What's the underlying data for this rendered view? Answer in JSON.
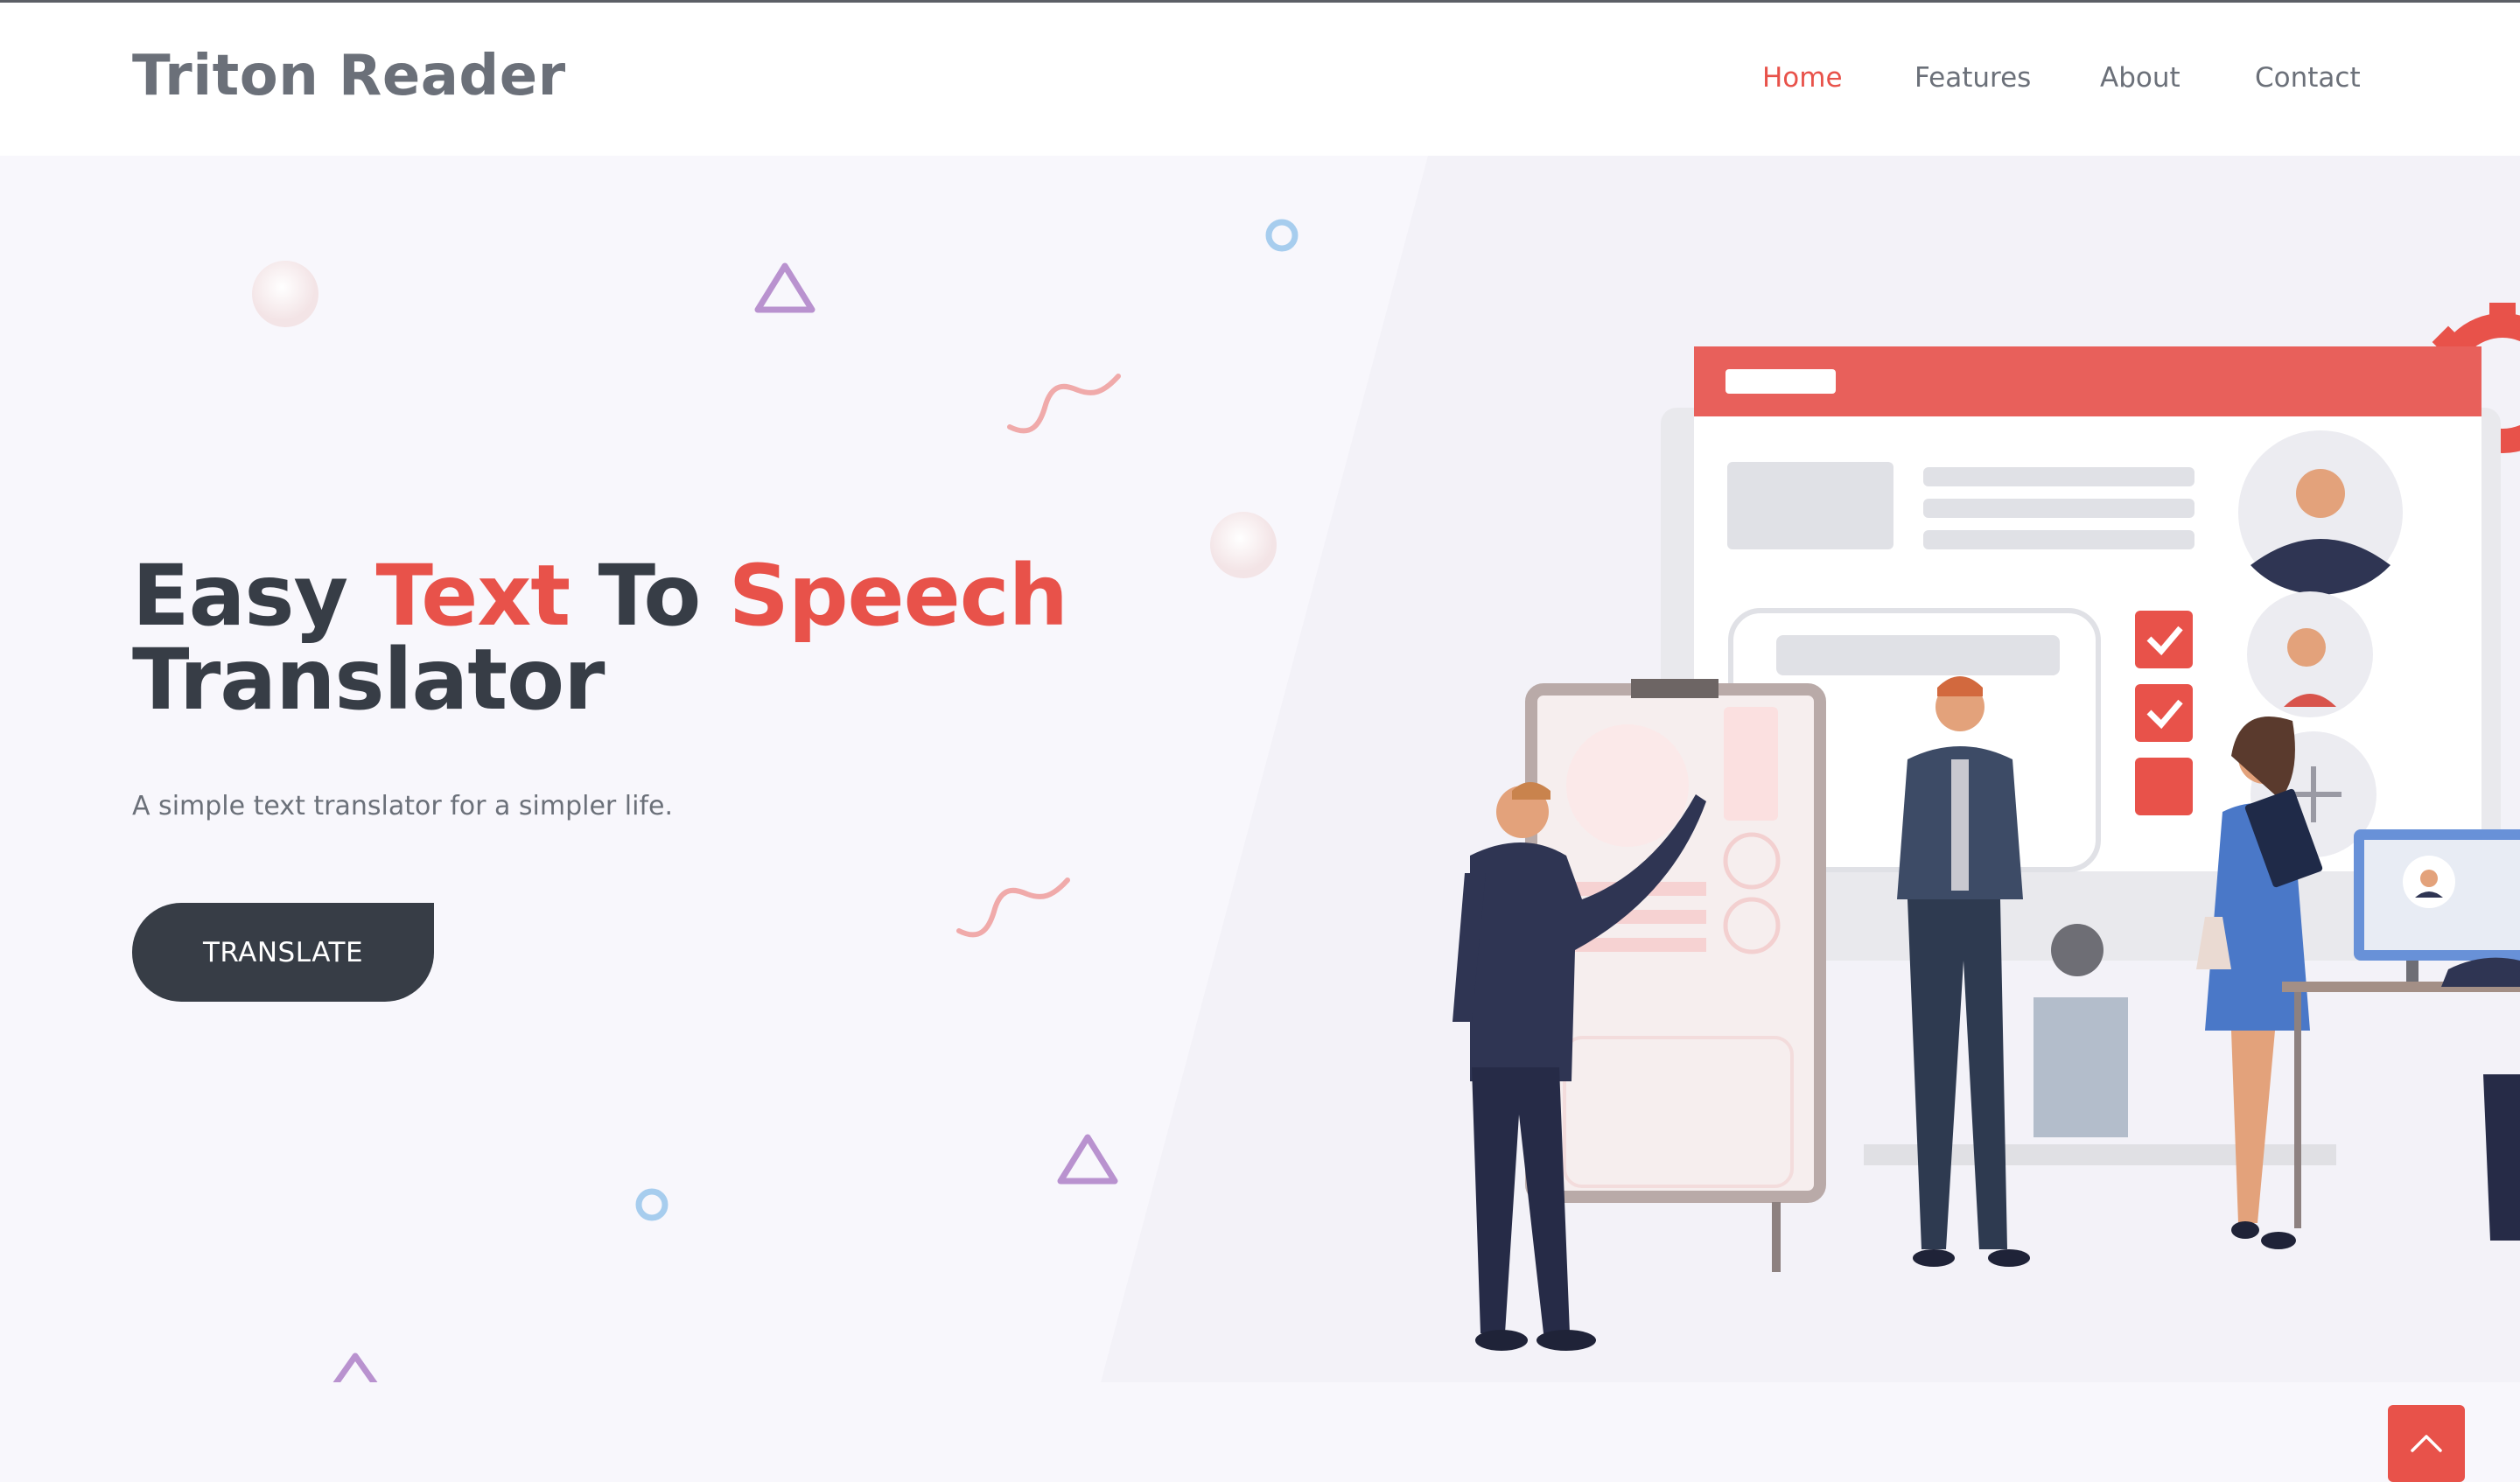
{
  "header": {
    "brand": "Triton Reader",
    "nav": [
      {
        "label": "Home",
        "active": true
      },
      {
        "label": "Features",
        "active": false
      },
      {
        "label": "About",
        "active": false
      },
      {
        "label": "Contact",
        "active": false
      }
    ]
  },
  "hero": {
    "headline": {
      "line1_part1": "Easy ",
      "line1_accent1": "Text",
      "line1_part2": " To ",
      "line1_accent2": "Speech",
      "line2": "Translator"
    },
    "subtitle": "A simple text translator for a simpler life.",
    "cta_label": "TRANSLATE"
  },
  "icons": {
    "scroll_top": "chevron-up-icon"
  },
  "colors": {
    "accent": "#e8524a",
    "dark": "#373d46",
    "muted_text": "#6b7079",
    "background": "#f8f7fc"
  }
}
